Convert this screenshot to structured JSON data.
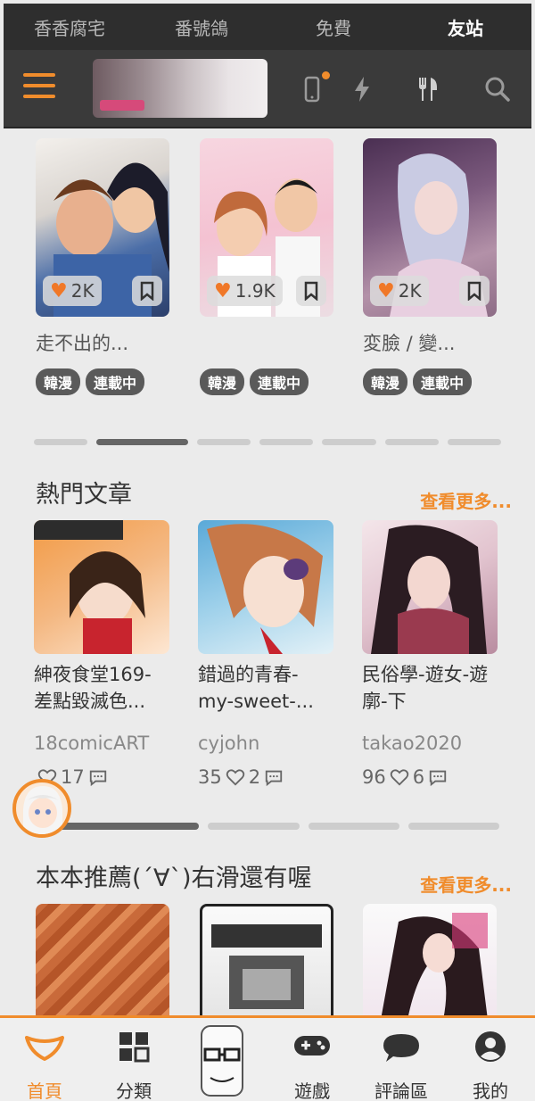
{
  "top_tabs": [
    {
      "label": "香香腐宅",
      "active": false
    },
    {
      "label": "番號鴿",
      "active": false
    },
    {
      "label": "免費",
      "active": false
    },
    {
      "label": "友站",
      "active": true
    }
  ],
  "header": {
    "icons": [
      "menu-icon",
      "phone-icon",
      "lightning-icon",
      "fork-knife-icon",
      "search-icon"
    ],
    "accent_color": "#f08c2c"
  },
  "comics": [
    {
      "likes": "2K",
      "title": "走不出的...",
      "tags": [
        "韓漫",
        "連載中"
      ]
    },
    {
      "likes": "1.9K",
      "title": "",
      "tags": [
        "韓漫",
        "連載中"
      ]
    },
    {
      "likes": "2K",
      "title": "変臉 / 變...",
      "tags": [
        "韓漫",
        "連載中"
      ]
    }
  ],
  "hot_articles": {
    "title": "熱門文章",
    "see_more": "查看更多...",
    "items": [
      {
        "title": "紳夜食堂169-差點毀滅色...",
        "author": "18comicART",
        "likes": "",
        "comments": "17"
      },
      {
        "title": "錯過的青春-my-sweet-...",
        "author": "cyjohn",
        "likes": "35",
        "comments": "2"
      },
      {
        "title": "民俗學-遊女-遊廓-下",
        "author": "takao2020",
        "likes": "96",
        "comments": "6"
      }
    ]
  },
  "recommend": {
    "title": "本本推薦(ˊ∀ˋ)右滑還有喔",
    "see_more": "查看更多..."
  },
  "bottom_nav": [
    {
      "label": "首頁",
      "icon": "home-icon",
      "active": true
    },
    {
      "label": "分類",
      "icon": "grid-icon",
      "active": false
    },
    {
      "label": "遊戲",
      "icon": "gamepad-icon",
      "active": false
    },
    {
      "label": "評論區",
      "icon": "chat-icon",
      "active": false
    },
    {
      "label": "我的",
      "icon": "user-icon",
      "active": false
    }
  ]
}
